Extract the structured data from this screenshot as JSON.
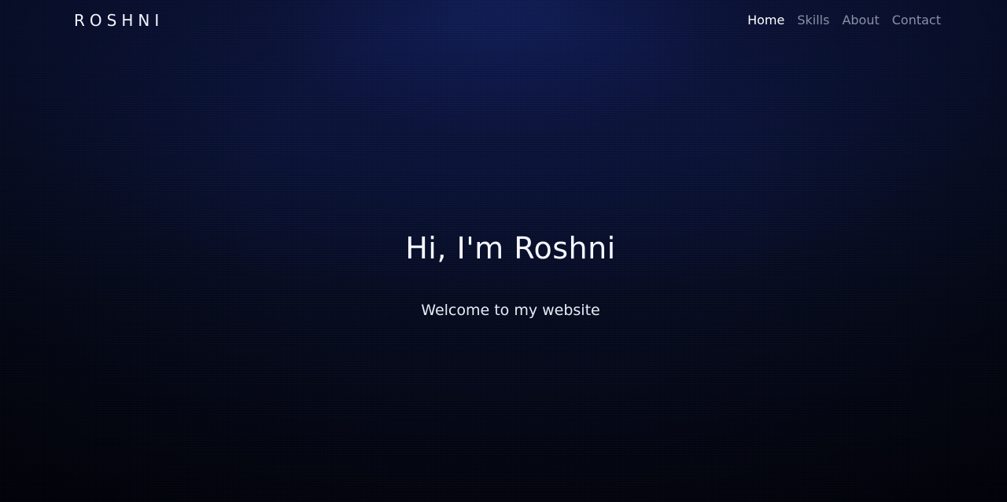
{
  "header": {
    "logo": "ROSHNI",
    "nav": [
      {
        "label": "Home",
        "active": true
      },
      {
        "label": "Skills",
        "active": false
      },
      {
        "label": "About",
        "active": false
      },
      {
        "label": "Contact",
        "active": false
      }
    ]
  },
  "hero": {
    "title": "Hi, I'm Roshni",
    "subtitle": "Welcome to my website"
  },
  "colors": {
    "background_top": "#0b1540",
    "background_bottom": "#020410",
    "nav_active": "#ffffff",
    "nav_inactive": "#8a90a6"
  }
}
